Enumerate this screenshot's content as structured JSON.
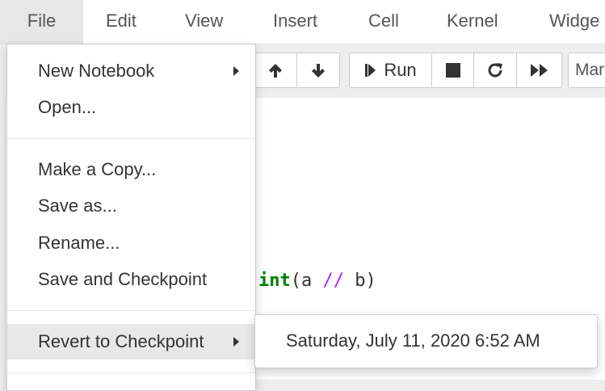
{
  "menubar": {
    "items": [
      "File",
      "Edit",
      "View",
      "Insert",
      "Cell",
      "Kernel",
      "Widge"
    ]
  },
  "toolbar": {
    "move_up_icon": "arrow-up-icon",
    "move_down_icon": "arrow-down-icon",
    "run_label": "Run",
    "run_icon": "step-forward-icon",
    "interrupt_icon": "stop-icon",
    "restart_icon": "redo-icon",
    "restart_run_all_icon": "fast-forward-icon",
    "cell_type_value": "Markdown"
  },
  "file_menu": {
    "items": [
      "New Notebook",
      "Open...",
      "Make a Copy...",
      "Save as...",
      "Rename...",
      "Save and Checkpoint",
      "Revert to Checkpoint"
    ]
  },
  "checkpoint_submenu": {
    "items": [
      "Saturday, July 11, 2020 6:52 AM"
    ]
  },
  "code_cell": {
    "keyword": "int",
    "rest_open": "(a ",
    "operator": "//",
    "rest_close": " b)"
  }
}
